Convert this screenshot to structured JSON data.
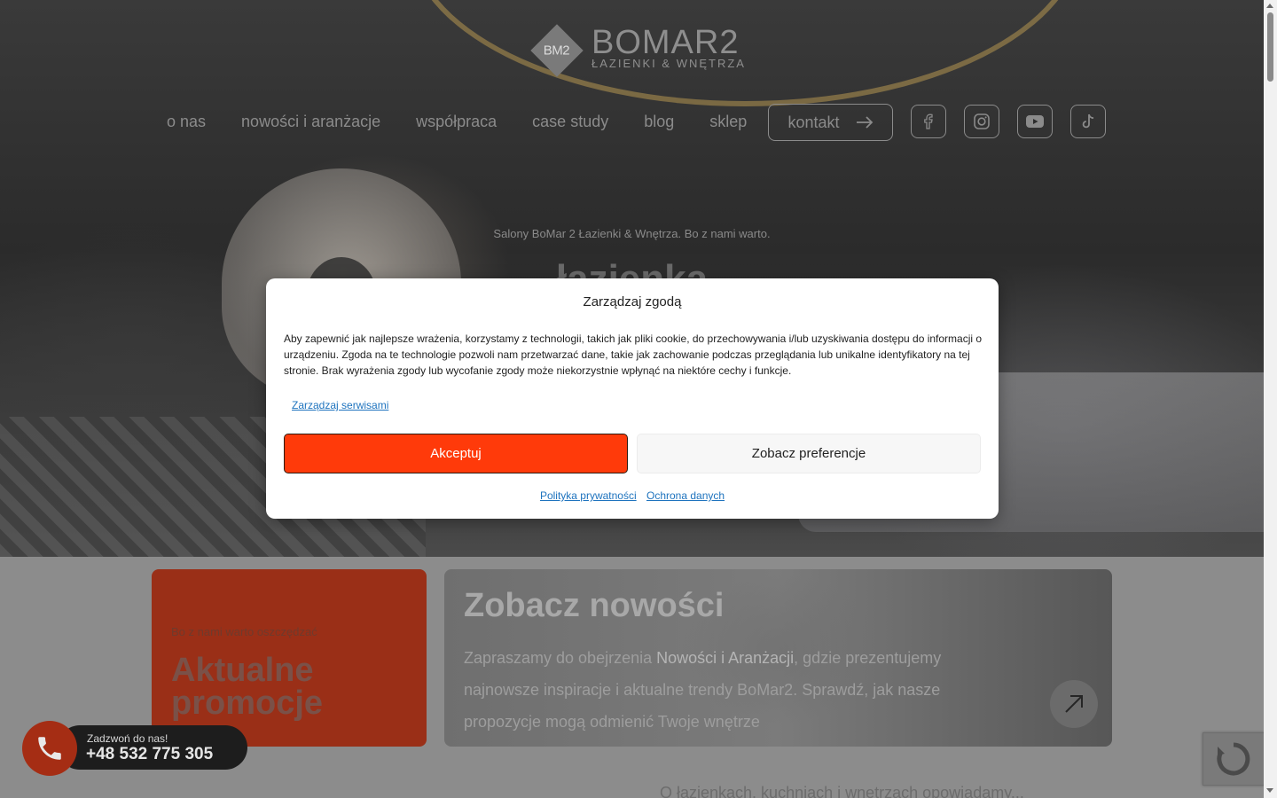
{
  "header": {
    "logo_mark": "BM2",
    "logo_name": "BOMAR2",
    "logo_sub": "ŁAZIENKI & WNĘTRZA",
    "nav": [
      "o nas",
      "nowości i aranżacje",
      "współpraca",
      "case study",
      "blog",
      "sklep"
    ],
    "contact_label": "kontakt",
    "social_icons": [
      "facebook-icon",
      "instagram-icon",
      "youtube-icon",
      "tiktok-icon"
    ]
  },
  "hero": {
    "tagline": "Salony BoMar 2 Łazienki & Wnętrza. Bo z nami warto.",
    "title": "łazienka"
  },
  "promo": {
    "subtitle": "Bo z nami warto oszczędzać",
    "title": "Aktualne promocje"
  },
  "news": {
    "title": "Zobacz nowości",
    "text_before": "Zapraszamy do obejrzenia ",
    "text_bold": "Nowości i Aranżacji",
    "text_after": ", gdzie prezentujemy najnowsze inspiracje i aktualne trendy BoMar2. Sprawdź, jak nasze propozycje mogą odmienić Twoje wnętrze"
  },
  "bottom_text": "O łazienkach, kuchniach i wnętrzach opowiadamy...",
  "call_widget": {
    "label": "Zadzwoń do nas!",
    "phone": "+48 532 775 305"
  },
  "consent_modal": {
    "title": "Zarządzaj zgodą",
    "body": "Aby zapewnić jak najlepsze wrażenia, korzystamy z technologii, takich jak pliki cookie, do przechowywania i/lub uzyskiwania dostępu do informacji o urządzeniu. Zgoda na te technologie pozwoli nam przetwarzać dane, takie jak zachowanie podczas przeglądania lub unikalne identyfikatory na tej stronie. Brak wyrażenia zgody lub wycofanie zgody może niekorzystnie wpłynąć na niektóre cechy i funkcje.",
    "manage_link": "Zarządzaj serwisami",
    "accept_label": "Akceptuj",
    "prefs_label": "Zobacz preferencje",
    "privacy_link": "Polityka prywatności",
    "data_link": "Ochrona danych"
  },
  "colors": {
    "accent": "#ff3a0a",
    "promo_card": "#9a2f17",
    "link": "#1e73be"
  }
}
